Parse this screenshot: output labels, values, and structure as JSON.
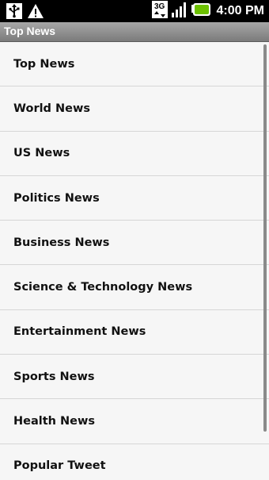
{
  "status_bar": {
    "time": "4:00 PM",
    "network": "3G",
    "icons": [
      "usb-icon",
      "warning-icon",
      "network-3g-icon",
      "signal-icon",
      "battery-icon"
    ]
  },
  "title_bar": {
    "title": "Top News"
  },
  "list": {
    "items": [
      {
        "label": "Top News"
      },
      {
        "label": "World News"
      },
      {
        "label": "US News"
      },
      {
        "label": "Politics News"
      },
      {
        "label": "Business News"
      },
      {
        "label": "Science & Technology News"
      },
      {
        "label": "Entertainment News"
      },
      {
        "label": "Sports News"
      },
      {
        "label": "Health News"
      },
      {
        "label": "Popular Tweet"
      }
    ]
  },
  "colors": {
    "status_bar_bg": "#000000",
    "title_bar_bg": "#8f8f8f",
    "list_bg": "#f6f6f6",
    "battery": "#6cc000"
  }
}
